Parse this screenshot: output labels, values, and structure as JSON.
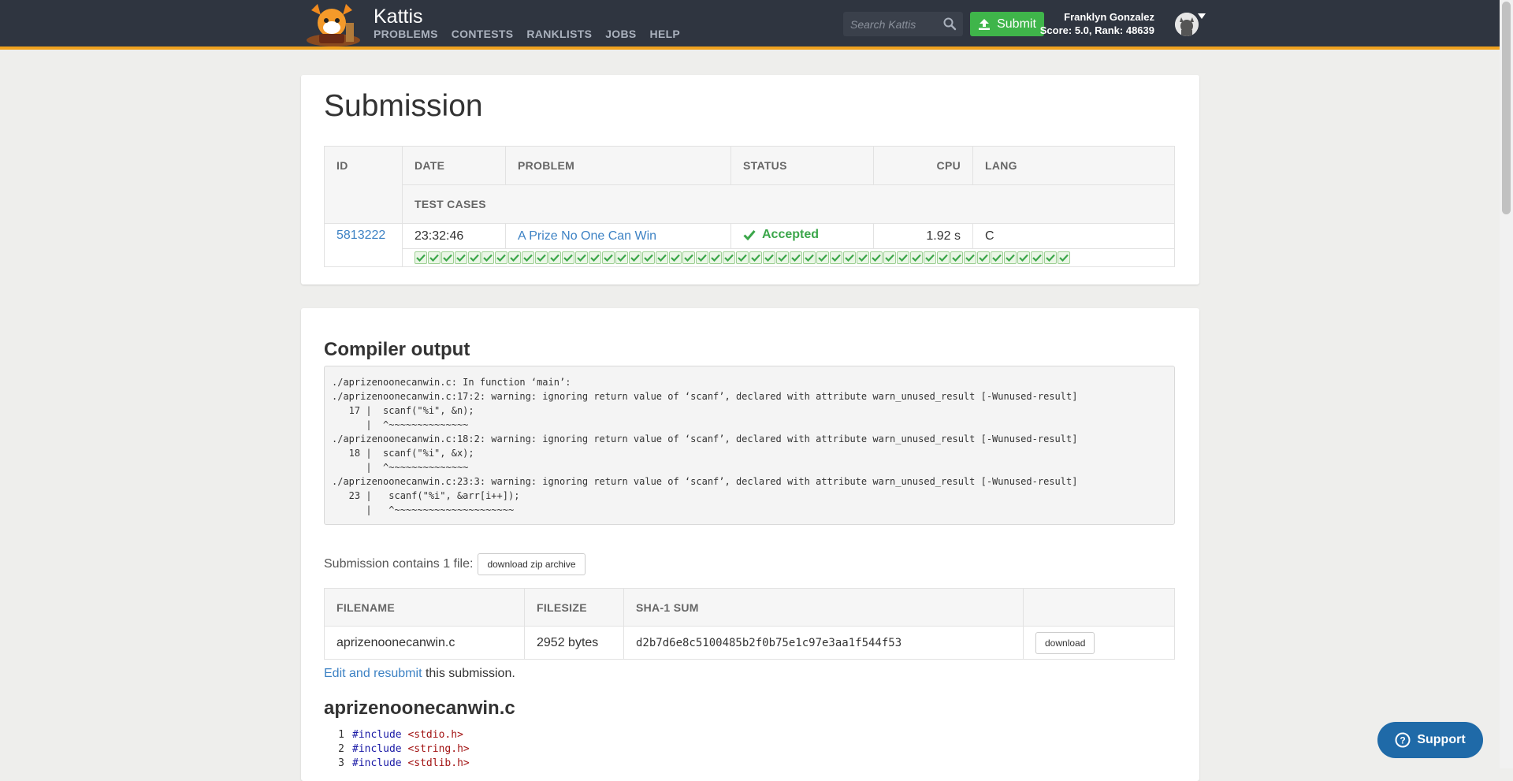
{
  "navbar": {
    "brand": "Kattis",
    "links": [
      "PROBLEMS",
      "CONTESTS",
      "RANKLISTS",
      "JOBS",
      "HELP"
    ],
    "search_placeholder": "Search Kattis",
    "submit_label": "Submit",
    "user_name": "Franklyn Gonzalez",
    "user_score": "Score: 5.0, Rank: 48639"
  },
  "submission": {
    "title": "Submission",
    "headers": {
      "id": "ID",
      "date": "DATE",
      "problem": "PROBLEM",
      "status": "STATUS",
      "cpu": "CPU",
      "lang": "LANG",
      "test_cases": "TEST CASES"
    },
    "row": {
      "id": "5813222",
      "date": "23:32:46",
      "problem": "A Prize No One Can Win",
      "status": "Accepted",
      "cpu": "1.92 s",
      "lang": "C"
    },
    "test_cases_passed": 49
  },
  "compiler": {
    "title": "Compiler output",
    "output": "./aprizenoonecanwin.c: In function ‘main’:\n./aprizenoonecanwin.c:17:2: warning: ignoring return value of ‘scanf’, declared with attribute warn_unused_result [-Wunused-result]\n   17 |  scanf(\"%i\", &n);\n      |  ^~~~~~~~~~~~~~~\n./aprizenoonecanwin.c:18:2: warning: ignoring return value of ‘scanf’, declared with attribute warn_unused_result [-Wunused-result]\n   18 |  scanf(\"%i\", &x);\n      |  ^~~~~~~~~~~~~~~\n./aprizenoonecanwin.c:23:3: warning: ignoring return value of ‘scanf’, declared with attribute warn_unused_result [-Wunused-result]\n   23 |   scanf(\"%i\", &arr[i++]);\n      |   ^~~~~~~~~~~~~~~~~~~~~~"
  },
  "files": {
    "contains_text": "Submission contains 1 file:",
    "zip_button": "download zip archive",
    "headers": {
      "filename": "FILENAME",
      "filesize": "FILESIZE",
      "sha": "SHA-1 SUM"
    },
    "row": {
      "filename": "aprizenoonecanwin.c",
      "filesize": "2952 bytes",
      "sha": "d2b7d6e8c5100485b2f0b75e1c97e3aa1f544f53",
      "download_label": "download"
    },
    "resubmit_link": "Edit and resubmit",
    "resubmit_suffix": " this submission."
  },
  "source": {
    "filename": "aprizenoonecanwin.c",
    "lines": [
      {
        "n": "1",
        "directive": "#include",
        "header": "<stdio.h>"
      },
      {
        "n": "2",
        "directive": "#include",
        "header": "<string.h>"
      },
      {
        "n": "3",
        "directive": "#include",
        "header": "<stdlib.h>"
      }
    ]
  },
  "support_label": "Support",
  "colors": {
    "navbar": "#2f3540",
    "accent": "#f0a21e",
    "submit": "#3fb54a",
    "link": "#3d82c4",
    "accepted": "#3ba64a",
    "support": "#1f6aa8"
  }
}
